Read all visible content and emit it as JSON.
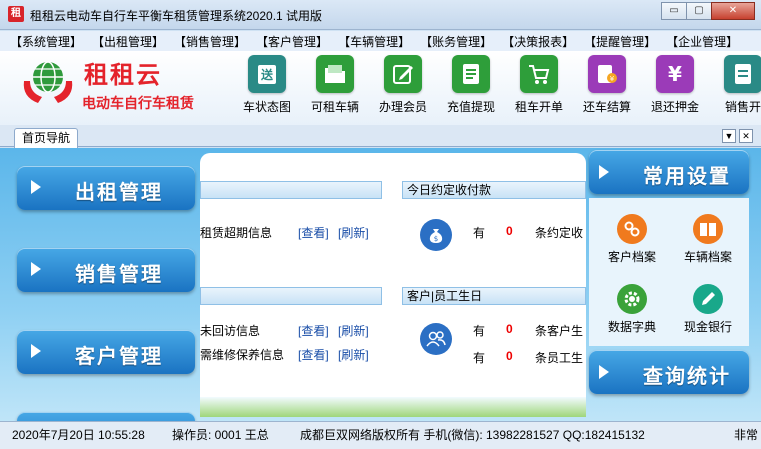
{
  "window": {
    "title": "租租云电动车自行车平衡车租赁管理系统2020.1 试用版",
    "icon_text": "租",
    "minimize": "▭",
    "maximize": "▢",
    "close": "✕"
  },
  "menu": [
    "【系统管理】",
    "【出租管理】",
    "【销售管理】",
    "【客户管理】",
    "【车辆管理】",
    "【账务管理】",
    "【决策报表】",
    "【提醒管理】",
    "【企业管理】"
  ],
  "brand": {
    "name": "租租云",
    "slogan": "电动车自行车租赁"
  },
  "toolbar": [
    {
      "label": "车状态图",
      "icon": "delivery-icon",
      "glyph": "送",
      "color": "#2a8a86"
    },
    {
      "label": "可租车辆",
      "icon": "folder-icon",
      "glyph": "",
      "color": "#2e9e3a"
    },
    {
      "label": "办理会员",
      "icon": "edit-icon",
      "glyph": "",
      "color": "#2e9e3a"
    },
    {
      "label": "充值提现",
      "icon": "document-icon",
      "glyph": "",
      "color": "#2e9e3a"
    },
    {
      "label": "租车开单",
      "icon": "cart-icon",
      "glyph": "",
      "color": "#2e9e3a"
    },
    {
      "label": "还车结算",
      "icon": "bill-icon",
      "glyph": "",
      "color": "#9b3bb8"
    },
    {
      "label": "退还押金",
      "icon": "yen-icon",
      "glyph": "¥",
      "color": "#9b3bb8"
    },
    {
      "label": "销售开",
      "icon": "receipt-icon",
      "glyph": "",
      "color": "#2a8a86"
    }
  ],
  "tab": {
    "label": "首页导航",
    "menu": "▼",
    "close": "✕"
  },
  "left_nav": [
    "出租管理",
    "销售管理",
    "客户管理"
  ],
  "panel": {
    "sections": [
      {
        "right_title": "今日约定收付款"
      },
      {
        "right_title": "客户|员工生日"
      }
    ],
    "rows": {
      "overdue": {
        "text": "租赁超期信息",
        "view": "[查看]",
        "refresh": "[刷新]"
      },
      "pay_have": "有",
      "pay_count": "0",
      "pay_text": "条约定收",
      "visit": {
        "text": "未回访信息",
        "view": "[查看]",
        "refresh": "[刷新]"
      },
      "repair": {
        "text": "需维修保养信息",
        "view": "[查看]",
        "refresh": "[刷新]"
      },
      "cust_have": "有",
      "cust_count": "0",
      "cust_text": "条客户生",
      "emp_have": "有",
      "emp_count": "0",
      "emp_text": "条员工生"
    }
  },
  "right": {
    "settings_title": "常用设置",
    "items": [
      {
        "label": "客户档案",
        "icon": "link-icon",
        "color": "#f07a1e"
      },
      {
        "label": "车辆档案",
        "icon": "book-icon",
        "color": "#f07a1e"
      },
      {
        "label": "数据字典",
        "icon": "gear-icon",
        "color": "#3aa23a"
      },
      {
        "label": "现金银行",
        "icon": "pencil-icon",
        "color": "#19a88a"
      }
    ],
    "query_title": "查询统计"
  },
  "status": {
    "datetime": "2020年7月20日 10:55:28",
    "operator": "操作员: 0001 王总",
    "copyright": "成都巨双网络版权所有 手机(微信): 13982281527 QQ:182415132",
    "extra": "非常"
  }
}
